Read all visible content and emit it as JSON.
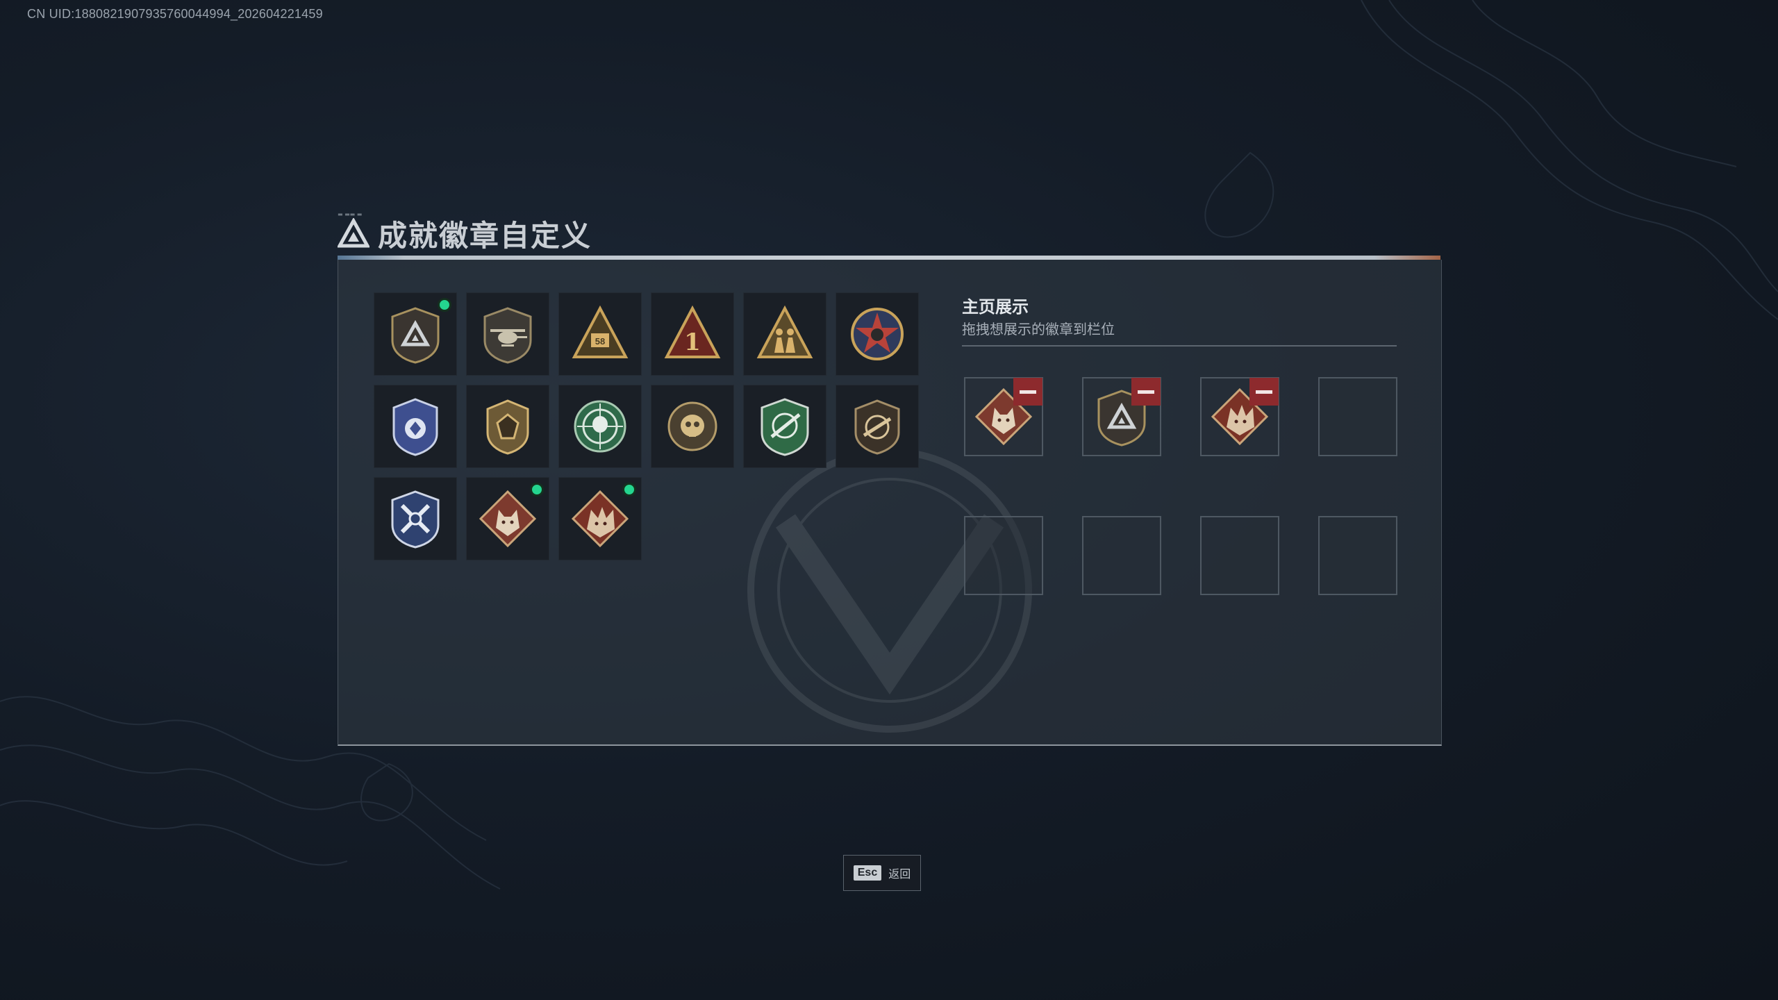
{
  "uid": "CN UID:1880821907935760044994_202604221459",
  "header": {
    "title": "成就徽章自定义"
  },
  "badges": [
    {
      "name": "shield-triangle-badge-icon",
      "selected": true
    },
    {
      "name": "helicopter-shield-badge-icon",
      "selected": false
    },
    {
      "name": "triangle-58-badge-icon",
      "selected": false
    },
    {
      "name": "triangle-number-one-badge-icon",
      "selected": false
    },
    {
      "name": "triangle-soldiers-badge-icon",
      "selected": false
    },
    {
      "name": "star-medal-badge-icon",
      "selected": false
    },
    {
      "name": "blue-wings-shield-badge-icon",
      "selected": false
    },
    {
      "name": "gold-gem-shield-badge-icon",
      "selected": false
    },
    {
      "name": "green-target-skull-badge-icon",
      "selected": false
    },
    {
      "name": "gold-skull-emblem-badge-icon",
      "selected": false
    },
    {
      "name": "green-crosshair-rifle-badge-icon",
      "selected": false
    },
    {
      "name": "rifle-crosshair-shield-badge-icon",
      "selected": false
    },
    {
      "name": "blue-crossed-arrows-badge-icon",
      "selected": false
    },
    {
      "name": "wolf-diamond-badge-icon",
      "selected": true
    },
    {
      "name": "dragon-diamond-badge-icon",
      "selected": true
    }
  ],
  "showcase": {
    "title": "主页展示",
    "subtitle": "拖拽想展示的徽章到栏位",
    "slots": [
      {
        "badge": "wolf-diamond-badge-icon"
      },
      {
        "badge": "shield-triangle-badge-icon"
      },
      {
        "badge": "dragon-diamond-badge-icon"
      },
      {
        "badge": null
      },
      {
        "badge": null
      },
      {
        "badge": null
      },
      {
        "badge": null
      },
      {
        "badge": null
      }
    ]
  },
  "footer": {
    "esc_key": "Esc",
    "esc_label": "返回"
  }
}
